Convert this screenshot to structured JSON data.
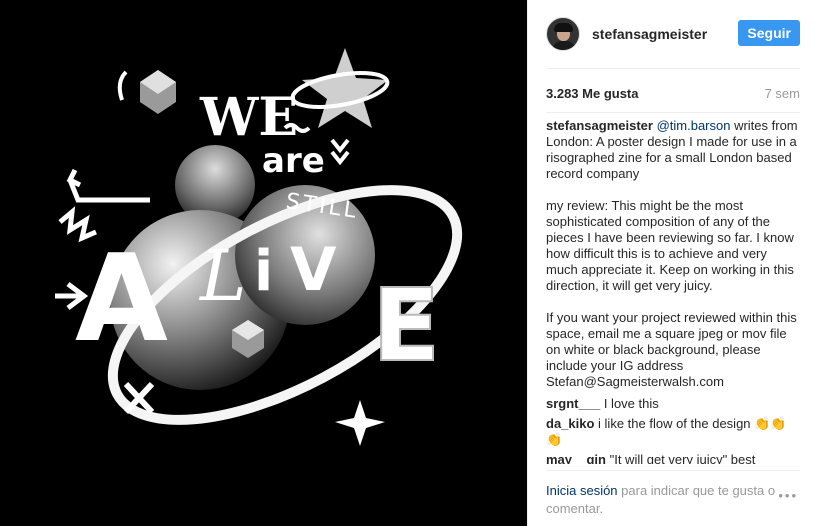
{
  "post": {
    "image_alt": "We are still alive poster",
    "poster_text": {
      "we": "WE",
      "are": "are",
      "still": "STILL",
      "alive_a": "A",
      "alive_l": "L",
      "alive_i": "i",
      "alive_v": "V",
      "alive_e": "E"
    }
  },
  "header": {
    "username": "stefansagmeister",
    "follow_label": "Seguir"
  },
  "stats": {
    "likes": "3.283 Me gusta",
    "age": "7 sem"
  },
  "caption": {
    "user": "stefansagmeister",
    "mention": "@tim.barson",
    "text1": " writes from London: A poster design I made for use in a risographed zine for a small London based record company",
    "text2": "my review: This might be the most sophisticated composition of any of the pieces I have been reviewing so far. I know how difficult this is to achieve and very much appreciate it. Keep on working in this direction, it will get very juicy.",
    "text3": "If you want your project reviewed within this space, email me a square jpeg or mov file on white or black background, please include your IG address Stefan@Sagmeisterwalsh.com"
  },
  "comments": [
    {
      "user": "srgnt___",
      "text": "I love this"
    },
    {
      "user": "da_kiko",
      "text": "i like the flow of the design",
      "emoji": "👏👏👏"
    },
    {
      "user": "may__gin",
      "text": "\"It will get very juicy\" best"
    }
  ],
  "footer": {
    "login_link": "Inicia sesión",
    "login_text": " para indicar que te gusta o comentar.",
    "more_icon": "more-options-icon",
    "more_label": "•••"
  },
  "colors": {
    "follow_button": "#3897f0",
    "link": "#003569",
    "muted": "#999999",
    "image_bg": "#000000"
  }
}
